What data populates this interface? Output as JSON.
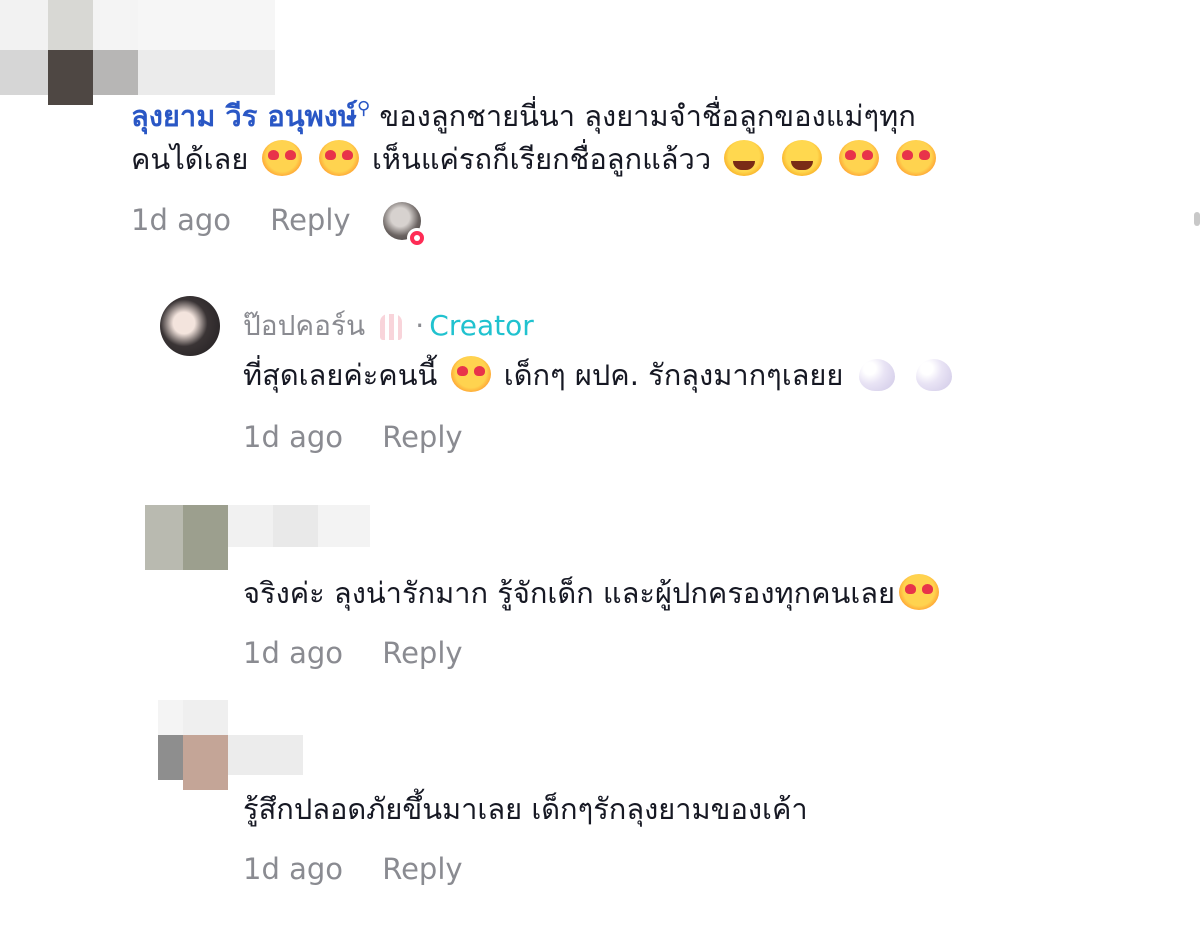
{
  "comments": [
    {
      "name": "ลุงยาม วีร อนุพงษ์",
      "line1": "ของลูกชายนี่นา ลุงยามจำชื่อลูกของแม่ๆทุก",
      "line2": "คนได้เลย",
      "line2b": "เห็นแค่รถก็เรียกชื่อลูกแล้วว",
      "time": "1d ago",
      "reply": "Reply"
    },
    {
      "name": "ป๊อปคอร์น",
      "badge_sep": "·",
      "badge": "Creator",
      "text": "ที่สุดเลยค่ะคนนี้",
      "text2": "เด็กๆ ผปค. รักลุงมากๆเลยย",
      "time": "1d ago",
      "reply": "Reply"
    },
    {
      "text": "จริงค่ะ ลุงน่ารักมาก รู้จักเด็ก และผู้ปกครองทุกคนเลย",
      "time": "1d ago",
      "reply": "Reply"
    },
    {
      "text": "รู้สึกปลอดภัยขึ้นมาเลย เด็กๆรักลุงยามของเค้า",
      "time": "1d ago",
      "reply": "Reply"
    }
  ],
  "icons": {
    "love_emoji": "smiling-face-with-hearts-icon",
    "laugh_emoji": "face-with-tears-of-joy-icon",
    "heart_emoji": "white-heart-icon",
    "popcorn": "popcorn-icon",
    "search": "search-icon"
  },
  "colors": {
    "name_blue": "#2a57c5",
    "creator_teal": "#20c2cf",
    "meta_grey": "#8a8b91"
  }
}
